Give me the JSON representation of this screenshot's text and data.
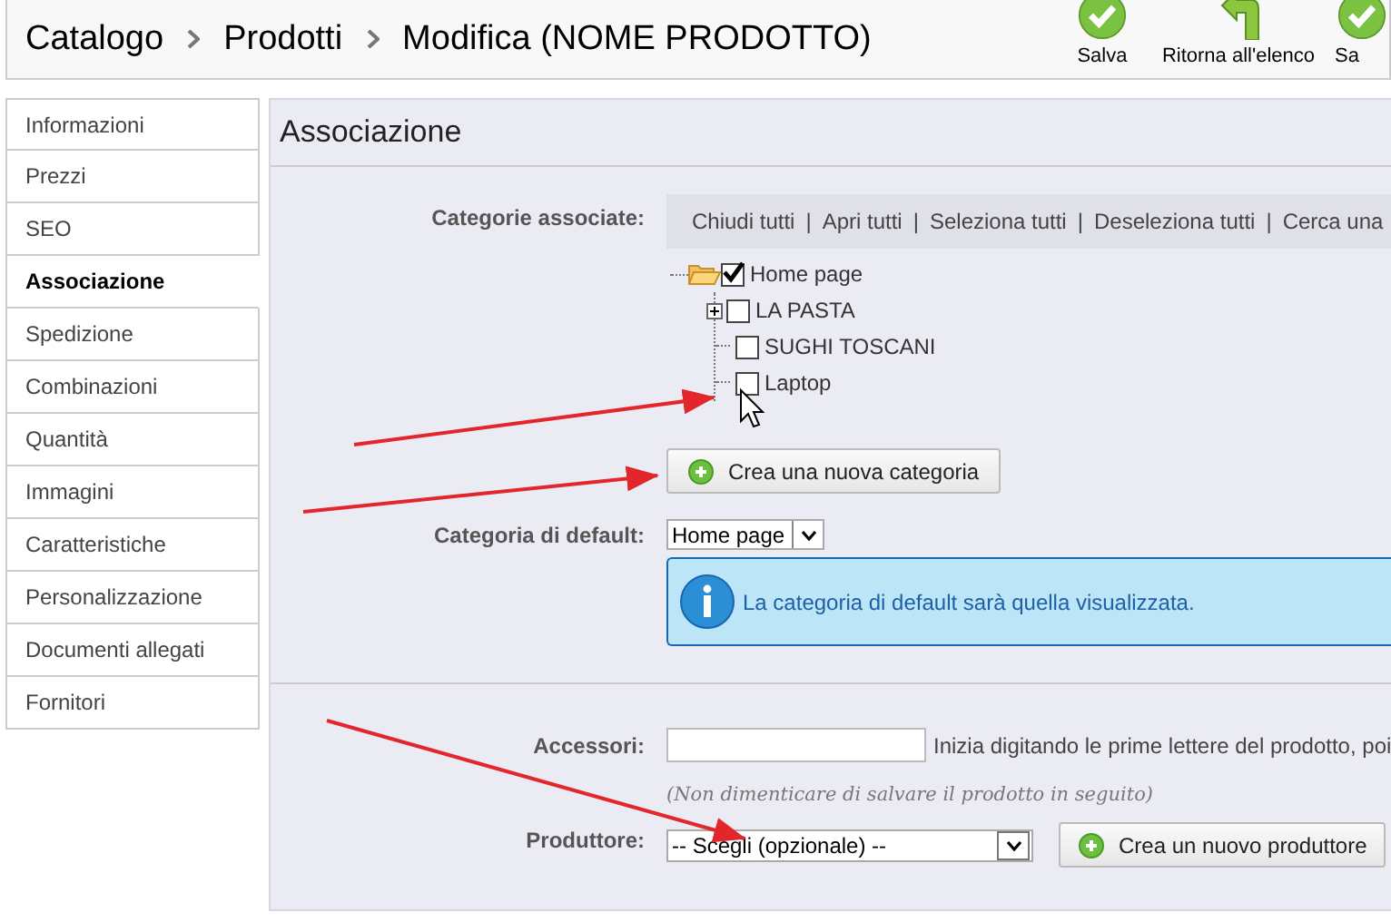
{
  "breadcrumb": [
    "Catalogo",
    "Prodotti",
    "Modifica (NOME PRODOTTO)"
  ],
  "toolbar": [
    {
      "label": "Salva",
      "kind": "save"
    },
    {
      "label": "Ritorna all'elenco",
      "kind": "back"
    },
    {
      "label": "Sa",
      "kind": "save"
    }
  ],
  "sidebar": {
    "items": [
      {
        "label": "Informazioni",
        "selected": false
      },
      {
        "label": "Prezzi",
        "selected": false
      },
      {
        "label": "SEO",
        "selected": false
      },
      {
        "label": "Associazione",
        "selected": true
      },
      {
        "label": "Spedizione",
        "selected": false
      },
      {
        "label": "Combinazioni",
        "selected": false
      },
      {
        "label": "Quantità",
        "selected": false
      },
      {
        "label": "Immagini",
        "selected": false
      },
      {
        "label": "Caratteristiche",
        "selected": false
      },
      {
        "label": "Personalizzazione",
        "selected": false
      },
      {
        "label": "Documenti allegati",
        "selected": false
      },
      {
        "label": "Fornitori",
        "selected": false
      }
    ]
  },
  "panel": {
    "title": "Associazione",
    "categories": {
      "label": "Categorie associate:",
      "separator": "|",
      "actions": [
        "Chiudi tutti",
        "Apri tutti",
        "Seleziona tutti",
        "Deseleziona tutti",
        "Cerca una"
      ],
      "tree": [
        {
          "label": "Home page",
          "checked": true,
          "expanded": true,
          "children": [
            {
              "label": "LA PASTA",
              "checked": false,
              "expanded": false,
              "has_children": true
            },
            {
              "label": "SUGHI TOSCANI",
              "checked": false,
              "has_children": false
            },
            {
              "label": "Laptop",
              "checked": false,
              "has_children": false
            }
          ]
        }
      ]
    },
    "new_category_button": "Crea una nuova categoria",
    "default_category": {
      "label": "Categoria di default:",
      "value": "Home page"
    },
    "info": "La categoria di default sarà quella visualizzata.",
    "accessories": {
      "label": "Accessori:",
      "hint": "Inizia digitando le prime lettere del prodotto, poi"
    },
    "note": "(Non dimenticare di salvare il prodotto in seguito)",
    "manufacturer": {
      "label": "Produttore:",
      "value": "-- Scegli (opzionale) --",
      "button": "Crea un nuovo produttore"
    }
  }
}
